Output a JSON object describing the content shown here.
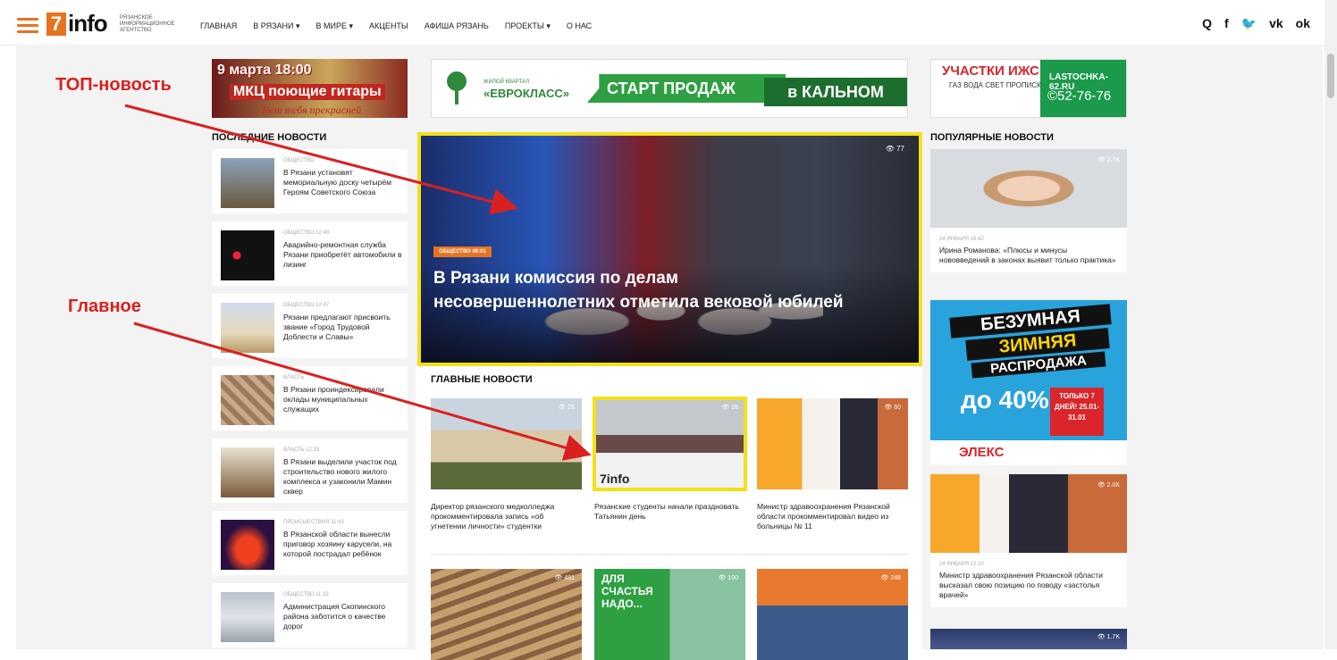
{
  "header": {
    "logo_seven": "7",
    "logo_word": "info",
    "logo_sub": "Рязанское информационное агентство",
    "nav": [
      "ГЛАВНАЯ",
      "В РЯЗАНИ ▾",
      "В МИРЕ ▾",
      "АКЦЕНТЫ",
      "АФИША РЯЗАНЬ",
      "ПРОЕКТЫ ▾",
      "О НАС"
    ],
    "icons": {
      "search": "Q",
      "facebook": "f",
      "twitter": "🐦",
      "vk": "vk",
      "ok": "ok"
    }
  },
  "banners": {
    "b1": {
      "line1": "9 марта 18:00",
      "line2": "МКЦ поющие гитары",
      "line3": "Нет тебя прекрасней"
    },
    "b2": {
      "small": "ЖИЛОЙ КВАРТАЛ",
      "brand": "«ЕВРОКЛАСС»",
      "green": "СТАРТ ПРОДАЖ",
      "dark": "в КАЛЬНОМ"
    },
    "b3": {
      "left_title": "УЧАСТКИ ИЖС",
      "left_sub": "ГАЗ ВОДА СВЕТ ПРОПИСКА",
      "url": "LASTOCHKA-62.RU",
      "phone": "©52-76-76"
    }
  },
  "latest": {
    "title": "ПОСЛЕДНИЕ НОВОСТИ",
    "items": [
      {
        "meta": "ОБЩЕСТВО",
        "title": "В Рязани установят мемориальную доску четырём Героям Советского Союза"
      },
      {
        "meta": "ОБЩЕСТВО 12:48",
        "title": "Аварийно-ремонтная служба Рязани приобретёт автомобили в лизинг"
      },
      {
        "meta": "ОБЩЕСТВО 12:47",
        "title": "Рязани предлагают присвоить звание «Город Трудовой Доблести и Славы»"
      },
      {
        "meta": "ВЛАСТЬ",
        "title": "В Рязани проиндексировали оклады муниципальных служащих"
      },
      {
        "meta": "ВЛАСТЬ 12:33",
        "title": "В Рязани выделили участок под строительство нового жилого комплекса и узаконили Мамин сквер"
      },
      {
        "meta": "ПРОИСШЕСТВИЯ 11:43",
        "title": "В Рязанской области вынесли приговор хозяину карусели, на которой пострадал ребёнок"
      },
      {
        "meta": "ОБЩЕСТВО 11:33",
        "title": "Администрация Скопинского района заботится о качестве дорог"
      }
    ]
  },
  "hero": {
    "views": "👁 77",
    "category": "ОБЩЕСТВО 09:01",
    "title": "В Рязани комиссия по делам несовершеннолетних отметила вековой юбилей"
  },
  "main_news": {
    "title": "ГЛАВНЫЕ НОВОСТИ",
    "cards": [
      {
        "views": "👁 26",
        "title": "Директор рязанского медколледжа прокомментировала запись «об угнетении личности» студентки"
      },
      {
        "views": "👁 28",
        "title": "Рязанские студенты начали праздновать Татьянин день",
        "watermark": "7info"
      },
      {
        "views": "👁 60",
        "title": "Министр здравоохранения Рязанской области прокомментировал видео из больницы № 11"
      },
      {
        "views": "👁 481",
        "title": ""
      },
      {
        "views": "👁 100",
        "title": "",
        "overlay": "ДЛЯ СЧАСТЬЯ НАДО..."
      },
      {
        "views": "👁 248",
        "title": ""
      }
    ]
  },
  "popular": {
    "title": "ПОПУЛЯРНЫЕ НОВОСТИ",
    "items": [
      {
        "views": "👁 2.7K",
        "date": "24 ЯНВАРЯ 18:42",
        "title": "Ирина Романова: «Плюсы и минусы нововведений в законах выявит только практика»"
      },
      {
        "views": "👁 2.0K",
        "date": "24 ЯНВАРЯ 12:10",
        "title": "Министр здравоохранения Рязанской области высказал свою позицию по поводу «застолья врачей»"
      },
      {
        "views": "👁 1.7K"
      }
    ],
    "sale": {
      "l1": "БЕЗУМНАЯ",
      "l2": "ЗИМНЯЯ",
      "l3": "РАСПРОДАЖА",
      "pct": "до 40%",
      "days": "ТОЛЬКО 7 ДНЕЙ! 25.01-31.01",
      "brand": "ЭЛЕКС"
    }
  },
  "annotations": {
    "top": "ТОП-новость",
    "main": "Главное"
  },
  "colors": {
    "accent": "#e8731f",
    "highlight": "#f2e01a",
    "annotation": "#d92020"
  }
}
